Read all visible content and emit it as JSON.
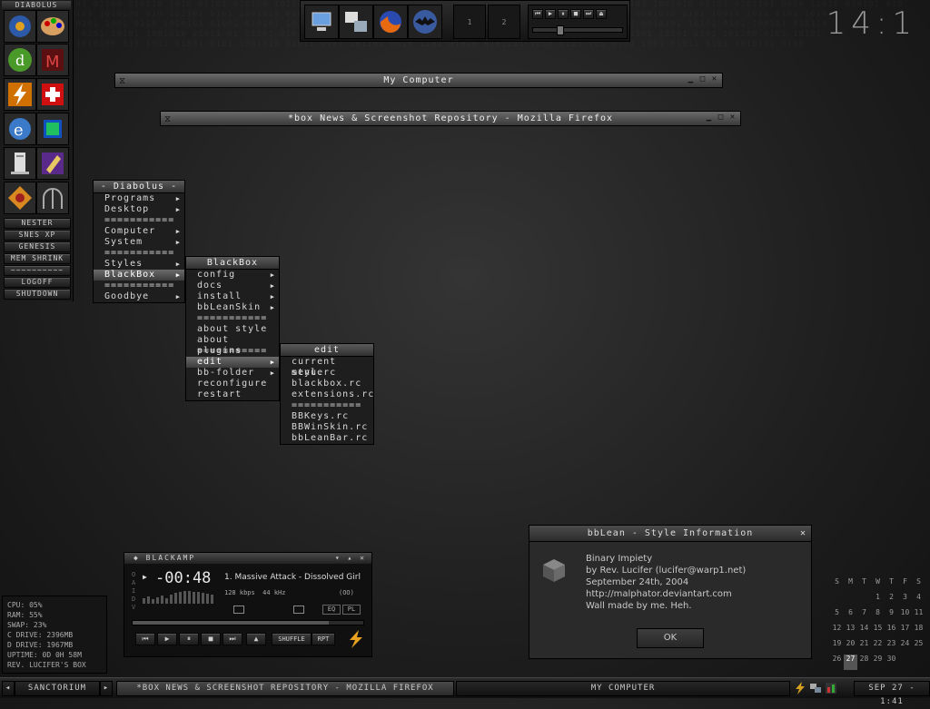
{
  "launcher": {
    "title": "DIABOLUS",
    "buttons": [
      "NESTER",
      "SNES XP",
      "GENESIS",
      "MEM SHRINK",
      "~~~~~~~~~~",
      "LOGOFF",
      "SHUTDOWN"
    ]
  },
  "dock": {
    "desk1": "1",
    "desk2": "2"
  },
  "clock": "14:1",
  "windows": {
    "my_computer": "My Computer",
    "firefox": "*box News & Screenshot Repository - Mozilla Firefox"
  },
  "main_menu": {
    "title": "- Diabolus -",
    "items": [
      "Programs",
      "Desktop",
      "===========",
      "Computer",
      "System",
      "===========",
      "Styles",
      "BlackBox",
      "===========",
      "Goodbye"
    ]
  },
  "blackbox_menu": {
    "title": "BlackBox",
    "items": [
      "config",
      "docs",
      "install",
      "bbLeanSkin",
      "===========",
      "about style",
      "about plugins",
      "===========",
      "edit",
      "bb-folder",
      "reconfigure",
      "restart"
    ]
  },
  "edit_menu": {
    "title": "edit",
    "items": [
      "current style",
      "menu.rc",
      "blackbox.rc",
      "extensions.rc",
      "===========",
      "BBKeys.rc",
      "BBWinSkin.rc",
      "bbLeanBar.rc"
    ]
  },
  "amp": {
    "title": "BLACKAMP",
    "time": "-00:48",
    "track": "1. Massive Attack - Dissolved Girl",
    "kbps": "128",
    "kbps_label": "kbps",
    "khz": "44",
    "khz_label": "kHz",
    "mode": "(OO)",
    "eq": "EQ",
    "pl": "PL",
    "shuffle": "SHUFFLE",
    "rpt": "RPT",
    "oaidv": "O A I D V",
    "progress": 0.85
  },
  "stats": {
    "lines": [
      "CPU: 05%",
      "RAM: 55%",
      "SWAP: 23%",
      "C DRIVE: 2396MB",
      "D DRIVE: 1967MB",
      "UPTIME: 0D 0H 58M",
      "REV. LUCIFER'S BOX"
    ]
  },
  "dialog": {
    "title": "bbLean - Style Information",
    "lines": [
      "Binary Impiety",
      "by Rev. Lucifer (lucifer@warp1.net)",
      "September 24th, 2004",
      "http://malphator.deviantart.com",
      "Wall made by me. Heh."
    ],
    "ok": "OK"
  },
  "calendar": {
    "header": [
      "S",
      "M",
      "T",
      "W",
      "T",
      "F",
      "S"
    ],
    "rows": [
      [
        "",
        "",
        "",
        "1",
        "2",
        "3",
        "4"
      ],
      [
        "5",
        "6",
        "7",
        "8",
        "9",
        "10",
        "11"
      ],
      [
        "12",
        "13",
        "14",
        "15",
        "16",
        "17",
        "18"
      ],
      [
        "19",
        "20",
        "21",
        "22",
        "23",
        "24",
        "25"
      ],
      [
        "26",
        "27",
        "28",
        "29",
        "30",
        "",
        ""
      ]
    ]
  },
  "taskbar": {
    "workspace": "SANCTORIUM",
    "task1": "*BOX NEWS & SCREENSHOT REPOSITORY - MOZILLA FIREFOX",
    "task2": "MY COMPUTER",
    "datetime": "SEP 27 - 1:41"
  }
}
